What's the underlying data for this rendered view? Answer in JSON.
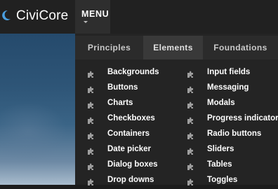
{
  "brand": {
    "name": "CiviCore",
    "accent": "#4a9fe0"
  },
  "header": {
    "menu_label": "MENU"
  },
  "dropdown": {
    "tabs": [
      {
        "label": "Principles"
      },
      {
        "label": "Elements",
        "active": true
      },
      {
        "label": "Foundations"
      }
    ],
    "left_column": [
      "Backgrounds",
      "Buttons",
      "Charts",
      "Checkboxes",
      "Containers",
      "Date picker",
      "Dialog boxes",
      "Drop downs"
    ],
    "right_column": [
      "Input fields",
      "Messaging",
      "Modals",
      "Progress indicators",
      "Radio buttons",
      "Sliders",
      "Tables",
      "Toggles"
    ],
    "item_icon": "puzzle-piece-icon",
    "icon_color": "#9e9e9e"
  }
}
